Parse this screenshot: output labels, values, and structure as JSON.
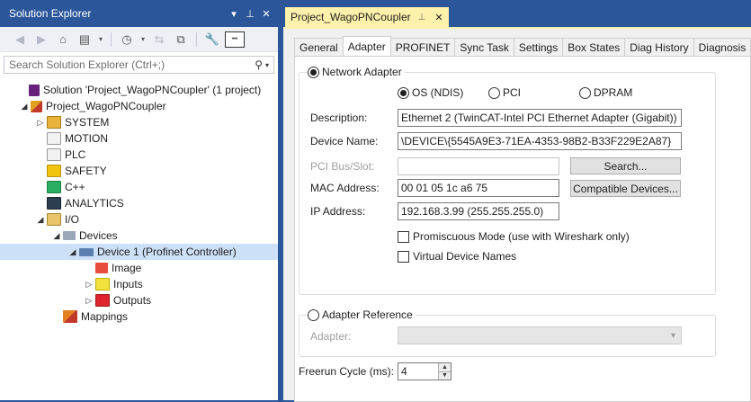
{
  "solution_explorer": {
    "title": "Solution Explorer",
    "title_buttons": [
      "▾",
      "ᵖ",
      "✕"
    ],
    "search_placeholder": "Search Solution Explorer (Ctrl+;)",
    "tree": [
      {
        "label": "Solution 'Project_WagoPNCoupler' (1 project)",
        "icon": "solution-icon",
        "indent": 0,
        "expander": ""
      },
      {
        "label": "Project_WagoPNCoupler",
        "icon": "project-icon",
        "indent": 0,
        "expander": "◢"
      },
      {
        "label": "SYSTEM",
        "icon": "system-icon",
        "indent": 1,
        "expander": "▷"
      },
      {
        "label": "MOTION",
        "icon": "motion-icon",
        "indent": 1,
        "expander": ""
      },
      {
        "label": "PLC",
        "icon": "plc-icon",
        "indent": 1,
        "expander": ""
      },
      {
        "label": "SAFETY",
        "icon": "safety-icon",
        "indent": 1,
        "expander": ""
      },
      {
        "label": "C++",
        "icon": "cpp-icon",
        "indent": 1,
        "expander": ""
      },
      {
        "label": "ANALYTICS",
        "icon": "analytics-icon",
        "indent": 1,
        "expander": ""
      },
      {
        "label": "I/O",
        "icon": "io-icon",
        "indent": 1,
        "expander": "◢"
      },
      {
        "label": "Devices",
        "icon": "devices-icon",
        "indent": 2,
        "expander": "◢"
      },
      {
        "label": "Device 1 (Profinet Controller)",
        "icon": "profinet-device-icon",
        "indent": 3,
        "expander": "◢",
        "selected": true
      },
      {
        "label": "Image",
        "icon": "image-icon",
        "indent": 4,
        "expander": ""
      },
      {
        "label": "Inputs",
        "icon": "inputs-icon",
        "indent": 4,
        "expander": "▷"
      },
      {
        "label": "Outputs",
        "icon": "outputs-icon",
        "indent": 4,
        "expander": "▷"
      },
      {
        "label": "Mappings",
        "icon": "mappings-icon",
        "indent": 2,
        "expander": ""
      }
    ]
  },
  "document": {
    "tab_title": "Project_WagoPNCoupler",
    "tabs": [
      "General",
      "Adapter",
      "PROFINET",
      "Sync Task",
      "Settings",
      "Box States",
      "Diag History",
      "Diagnosis"
    ],
    "active_tab": "Adapter",
    "network_adapter": {
      "label": "Network Adapter",
      "selected": true,
      "modes": [
        {
          "label": "OS (NDIS)",
          "selected": true
        },
        {
          "label": "PCI",
          "selected": false
        },
        {
          "label": "DPRAM",
          "selected": false
        }
      ],
      "description_label": "Description:",
      "description_value": "Ethernet 2 (TwinCAT-Intel PCI Ethernet Adapter (Gigabit))",
      "device_name_label": "Device Name:",
      "device_name_value": "\\DEVICE\\{5545A9E3-71EA-4353-98B2-B33F229E2A87}",
      "pci_label": "PCI Bus/Slot:",
      "pci_value": "",
      "search_button": "Search...",
      "mac_label": "MAC Address:",
      "mac_value": "00 01 05 1c a6 75",
      "compatible_button": "Compatible Devices...",
      "ip_label": "IP Address:",
      "ip_value": "192.168.3.99 (255.255.255.0)",
      "promiscuous_label": "Promiscuous Mode (use with Wireshark only)",
      "virtual_names_label": "Virtual Device Names"
    },
    "adapter_reference": {
      "label": "Adapter Reference",
      "selected": false,
      "adapter_label": "Adapter:"
    },
    "freerun": {
      "label": "Freerun Cycle (ms):",
      "value": "4"
    }
  }
}
